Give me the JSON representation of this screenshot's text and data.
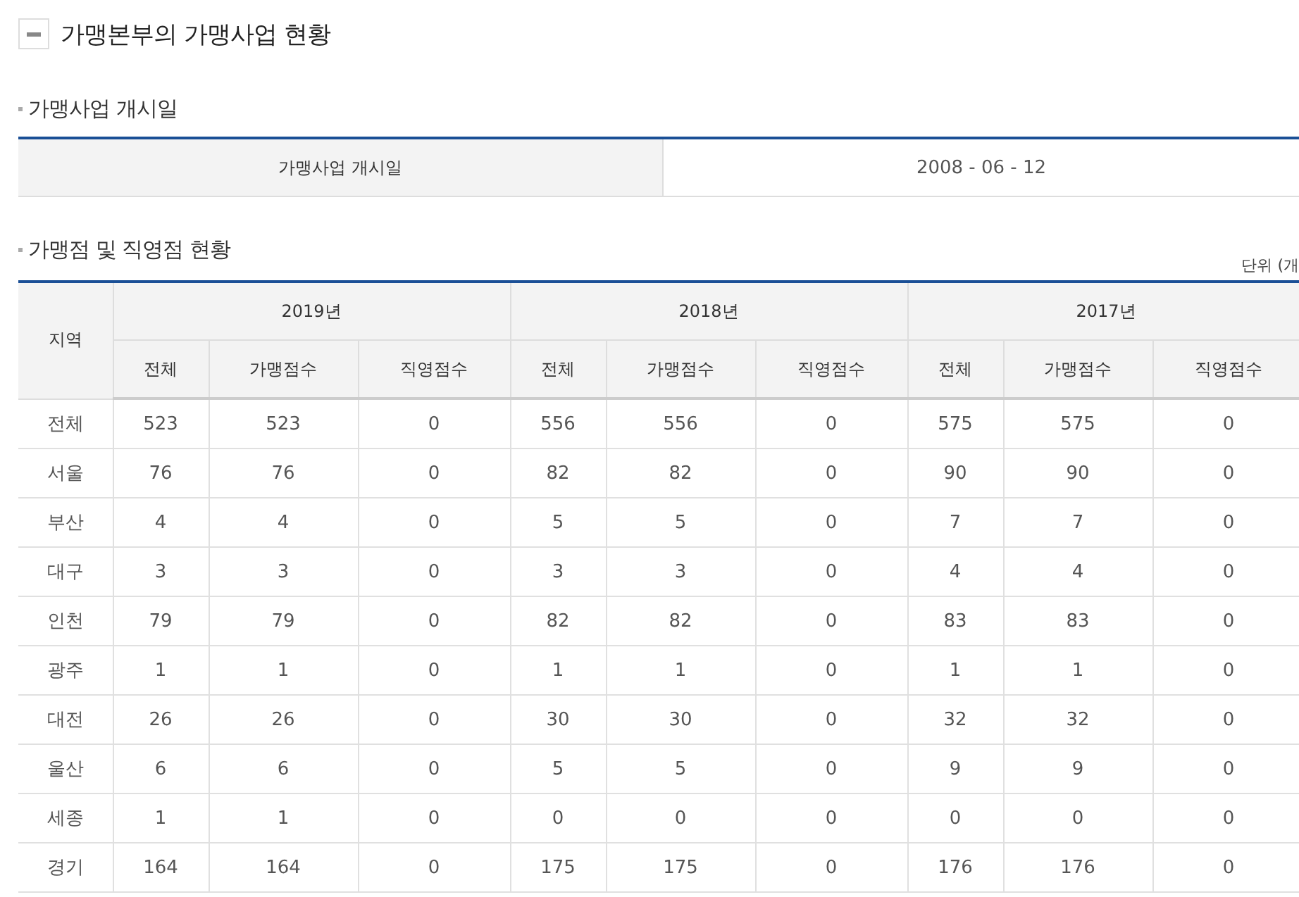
{
  "title": "가맹본부의 가맹사업 현황",
  "start_section": {
    "heading": "가맹사업 개시일",
    "label": "가맹사업 개시일",
    "value": "2008 - 06 - 12"
  },
  "store_section": {
    "heading": "가맹점 및 직영점 현황",
    "unit": "단위 (개",
    "table": {
      "region_header": "지역",
      "years": [
        {
          "label": "2019년",
          "sub_columns": [
            "전체",
            "가맹점수",
            "직영점수"
          ]
        },
        {
          "label": "2018년",
          "sub_columns": [
            "전체",
            "가맹점수",
            "직영점수"
          ]
        },
        {
          "label": "2017년",
          "sub_columns": [
            "전체",
            "가맹점수",
            "직영점수"
          ]
        }
      ],
      "rows": [
        {
          "region": "전체",
          "cells": [
            "523",
            "523",
            "0",
            "556",
            "556",
            "0",
            "575",
            "575",
            "0"
          ]
        },
        {
          "region": "서울",
          "cells": [
            "76",
            "76",
            "0",
            "82",
            "82",
            "0",
            "90",
            "90",
            "0"
          ]
        },
        {
          "region": "부산",
          "cells": [
            "4",
            "4",
            "0",
            "5",
            "5",
            "0",
            "7",
            "7",
            "0"
          ]
        },
        {
          "region": "대구",
          "cells": [
            "3",
            "3",
            "0",
            "3",
            "3",
            "0",
            "4",
            "4",
            "0"
          ]
        },
        {
          "region": "인천",
          "cells": [
            "79",
            "79",
            "0",
            "82",
            "82",
            "0",
            "83",
            "83",
            "0"
          ]
        },
        {
          "region": "광주",
          "cells": [
            "1",
            "1",
            "0",
            "1",
            "1",
            "0",
            "1",
            "1",
            "0"
          ]
        },
        {
          "region": "대전",
          "cells": [
            "26",
            "26",
            "0",
            "30",
            "30",
            "0",
            "32",
            "32",
            "0"
          ]
        },
        {
          "region": "울산",
          "cells": [
            "6",
            "6",
            "0",
            "5",
            "5",
            "0",
            "9",
            "9",
            "0"
          ]
        },
        {
          "region": "세종",
          "cells": [
            "1",
            "1",
            "0",
            "0",
            "0",
            "0",
            "0",
            "0",
            "0"
          ]
        },
        {
          "region": "경기",
          "cells": [
            "164",
            "164",
            "0",
            "175",
            "175",
            "0",
            "176",
            "176",
            "0"
          ]
        }
      ]
    }
  }
}
